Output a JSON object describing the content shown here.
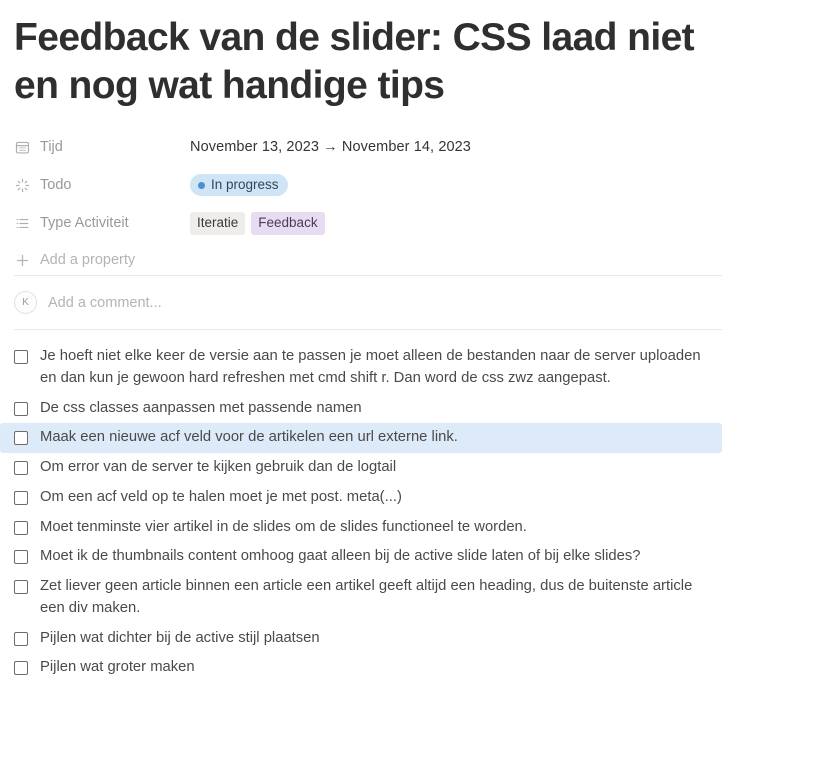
{
  "page": {
    "title": "Feedback van de slider: CSS laad niet en nog wat handige tips"
  },
  "properties": {
    "rows": [
      {
        "icon": "calendar-icon",
        "label": "Tijd",
        "value_type": "date",
        "value": "November 13, 2023 → November 14, 2023"
      },
      {
        "icon": "status-spinner-icon",
        "label": "Todo",
        "value_type": "status",
        "status": "In progress",
        "status_dot_color": "#4b8fcf",
        "status_bg_color": "#cfe4f5"
      },
      {
        "icon": "list-icon",
        "label": "Type Activiteit",
        "value_type": "tags",
        "tags": [
          {
            "label": "Iteratie",
            "color": "#eeedeb"
          },
          {
            "label": "Feedback",
            "color": "#e7dcf0"
          }
        ]
      }
    ],
    "add_property_label": "Add a property"
  },
  "comment": {
    "avatar_initial": "K",
    "placeholder": "Add a comment..."
  },
  "checklist": {
    "items": [
      {
        "text": "Je hoeft niet elke keer de versie aan te passen je moet alleen de bestanden naar de server uploaden en dan kun je gewoon hard refreshen met cmd shift r. Dan word de css zwz aangepast.",
        "checked": false,
        "selected": false
      },
      {
        "text": "De css classes aanpassen met passende namen",
        "checked": false,
        "selected": false
      },
      {
        "text": "Maak een nieuwe acf veld voor de artikelen een url externe link.",
        "checked": false,
        "selected": true
      },
      {
        "text": "Om error van de server  te kijken gebruik dan de logtail",
        "checked": false,
        "selected": false
      },
      {
        "text": "Om een acf veld op te halen moet je met post. meta(...)",
        "checked": false,
        "selected": false
      },
      {
        "text": "Moet tenminste vier artikel in de slides om de slides functioneel te worden.",
        "checked": false,
        "selected": false
      },
      {
        "text": "Moet ik de thumbnails content omhoog gaat alleen bij de active slide laten  of bij elke slides?",
        "checked": false,
        "selected": false
      },
      {
        "text": "Zet liever geen article binnen een article een artikel geeft altijd een heading, dus de buitenste article een div maken.",
        "checked": false,
        "selected": false
      },
      {
        "text": "Pijlen wat dichter bij de active stijl plaatsen",
        "checked": false,
        "selected": false
      },
      {
        "text": "Pijlen wat groter maken",
        "checked": false,
        "selected": false
      }
    ]
  }
}
